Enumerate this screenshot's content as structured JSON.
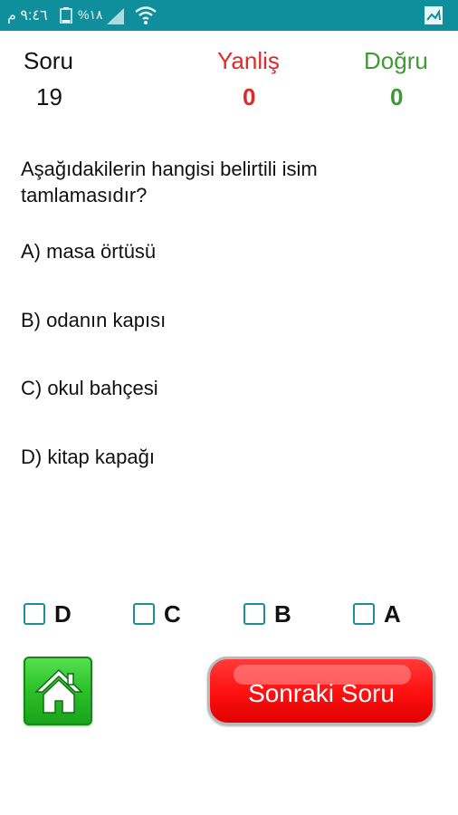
{
  "status_bar": {
    "time": "٩:٤٦ م",
    "battery": "%١٨",
    "background_color": "#0f8f9c"
  },
  "score": {
    "question_label": "Soru",
    "question_number": "19",
    "wrong_label": "Yanliş",
    "wrong_count": "0",
    "correct_label": "Doğru",
    "correct_count": "0",
    "wrong_color": "#dd2b2b",
    "correct_color": "#3f9a35"
  },
  "question": {
    "text": "Aşağıdakilerin hangisi belirtili isim tamlamasıdır?",
    "options": [
      "A) masa örtüsü",
      "B) odanın kapısı",
      "C) okul bahçesi",
      "D) kitap kapağı"
    ]
  },
  "answers": [
    {
      "label": "D",
      "checked": false
    },
    {
      "label": "C",
      "checked": false
    },
    {
      "label": "B",
      "checked": false
    },
    {
      "label": "A",
      "checked": false
    }
  ],
  "buttons": {
    "home_icon": "home-icon",
    "next_label": "Sonraki Soru"
  }
}
